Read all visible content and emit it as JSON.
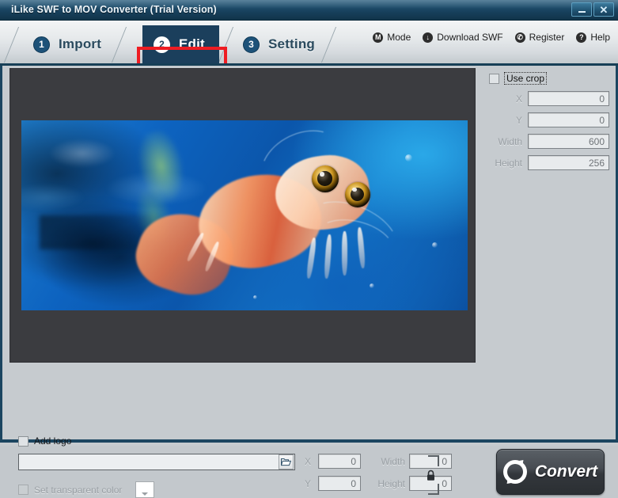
{
  "window": {
    "title": "iLike SWF to MOV Converter (Trial Version)",
    "minimize_label": "",
    "close_label": "✕"
  },
  "tabs": [
    {
      "number": "1",
      "label": "Import",
      "active": false
    },
    {
      "number": "2",
      "label": "Edit",
      "active": true
    },
    {
      "number": "3",
      "label": "Setting",
      "active": false
    }
  ],
  "topmenu": [
    {
      "icon": "M",
      "label": "Mode",
      "icon_name": "mode-icon"
    },
    {
      "icon": "↓",
      "label": "Download SWF",
      "icon_name": "download-icon"
    },
    {
      "icon": "✆",
      "label": "Register",
      "icon_name": "key-icon"
    },
    {
      "icon": "?",
      "label": "Help",
      "icon_name": "help-icon"
    }
  ],
  "crop": {
    "use_crop_label": "Use crop",
    "use_crop_checked": false,
    "fields": [
      {
        "label": "X",
        "value": "0"
      },
      {
        "label": "Y",
        "value": "0"
      },
      {
        "label": "Width",
        "value": "600"
      },
      {
        "label": "Height",
        "value": "256"
      }
    ]
  },
  "logo": {
    "add_logo_label": "Add logo",
    "add_logo_checked": false,
    "path_value": "",
    "path_placeholder": "",
    "browse_icon": "folder-open-icon",
    "transparent_label": "Set transparent color",
    "transparent_checked": false,
    "swatch_color": "#ffffff",
    "position": [
      {
        "label": "X",
        "value": "0"
      },
      {
        "label": "Y",
        "value": "0"
      }
    ],
    "size": [
      {
        "label": "Width",
        "value": "0"
      },
      {
        "label": "Height",
        "value": "0"
      }
    ],
    "lock_icon": "lock-icon"
  },
  "actions": {
    "convert_label": "Convert",
    "convert_icon": "recycle-icon"
  },
  "colors": {
    "titlebar": "#1e4d6b",
    "accent_red": "#ee1c22",
    "active_tab": "#1b3f5c",
    "panel": "#c6cbcf",
    "preview_bg": "#3b3c40"
  }
}
